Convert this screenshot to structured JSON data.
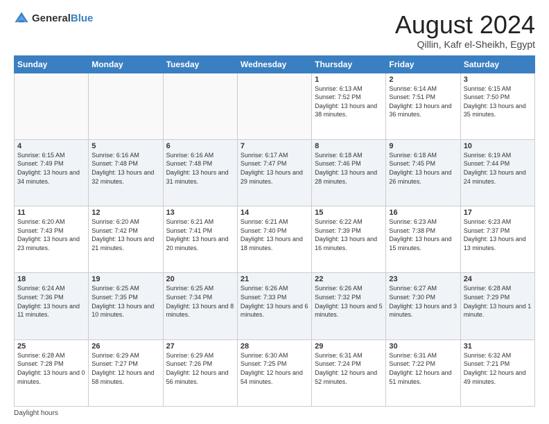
{
  "header": {
    "logo": {
      "general": "General",
      "blue": "Blue"
    },
    "title": "August 2024",
    "location": "Qillin, Kafr el-Sheikh, Egypt"
  },
  "days_of_week": [
    "Sunday",
    "Monday",
    "Tuesday",
    "Wednesday",
    "Thursday",
    "Friday",
    "Saturday"
  ],
  "weeks": [
    [
      {
        "day": "",
        "empty": true
      },
      {
        "day": "",
        "empty": true
      },
      {
        "day": "",
        "empty": true
      },
      {
        "day": "",
        "empty": true
      },
      {
        "day": "1",
        "sunrise": "6:13 AM",
        "sunset": "7:52 PM",
        "daylight": "13 hours and 38 minutes."
      },
      {
        "day": "2",
        "sunrise": "6:14 AM",
        "sunset": "7:51 PM",
        "daylight": "13 hours and 36 minutes."
      },
      {
        "day": "3",
        "sunrise": "6:15 AM",
        "sunset": "7:50 PM",
        "daylight": "13 hours and 35 minutes."
      }
    ],
    [
      {
        "day": "4",
        "sunrise": "6:15 AM",
        "sunset": "7:49 PM",
        "daylight": "13 hours and 34 minutes."
      },
      {
        "day": "5",
        "sunrise": "6:16 AM",
        "sunset": "7:48 PM",
        "daylight": "13 hours and 32 minutes."
      },
      {
        "day": "6",
        "sunrise": "6:16 AM",
        "sunset": "7:48 PM",
        "daylight": "13 hours and 31 minutes."
      },
      {
        "day": "7",
        "sunrise": "6:17 AM",
        "sunset": "7:47 PM",
        "daylight": "13 hours and 29 minutes."
      },
      {
        "day": "8",
        "sunrise": "6:18 AM",
        "sunset": "7:46 PM",
        "daylight": "13 hours and 28 minutes."
      },
      {
        "day": "9",
        "sunrise": "6:18 AM",
        "sunset": "7:45 PM",
        "daylight": "13 hours and 26 minutes."
      },
      {
        "day": "10",
        "sunrise": "6:19 AM",
        "sunset": "7:44 PM",
        "daylight": "13 hours and 24 minutes."
      }
    ],
    [
      {
        "day": "11",
        "sunrise": "6:20 AM",
        "sunset": "7:43 PM",
        "daylight": "13 hours and 23 minutes."
      },
      {
        "day": "12",
        "sunrise": "6:20 AM",
        "sunset": "7:42 PM",
        "daylight": "13 hours and 21 minutes."
      },
      {
        "day": "13",
        "sunrise": "6:21 AM",
        "sunset": "7:41 PM",
        "daylight": "13 hours and 20 minutes."
      },
      {
        "day": "14",
        "sunrise": "6:21 AM",
        "sunset": "7:40 PM",
        "daylight": "13 hours and 18 minutes."
      },
      {
        "day": "15",
        "sunrise": "6:22 AM",
        "sunset": "7:39 PM",
        "daylight": "13 hours and 16 minutes."
      },
      {
        "day": "16",
        "sunrise": "6:23 AM",
        "sunset": "7:38 PM",
        "daylight": "13 hours and 15 minutes."
      },
      {
        "day": "17",
        "sunrise": "6:23 AM",
        "sunset": "7:37 PM",
        "daylight": "13 hours and 13 minutes."
      }
    ],
    [
      {
        "day": "18",
        "sunrise": "6:24 AM",
        "sunset": "7:36 PM",
        "daylight": "13 hours and 11 minutes."
      },
      {
        "day": "19",
        "sunrise": "6:25 AM",
        "sunset": "7:35 PM",
        "daylight": "13 hours and 10 minutes."
      },
      {
        "day": "20",
        "sunrise": "6:25 AM",
        "sunset": "7:34 PM",
        "daylight": "13 hours and 8 minutes."
      },
      {
        "day": "21",
        "sunrise": "6:26 AM",
        "sunset": "7:33 PM",
        "daylight": "13 hours and 6 minutes."
      },
      {
        "day": "22",
        "sunrise": "6:26 AM",
        "sunset": "7:32 PM",
        "daylight": "13 hours and 5 minutes."
      },
      {
        "day": "23",
        "sunrise": "6:27 AM",
        "sunset": "7:30 PM",
        "daylight": "13 hours and 3 minutes."
      },
      {
        "day": "24",
        "sunrise": "6:28 AM",
        "sunset": "7:29 PM",
        "daylight": "13 hours and 1 minute."
      }
    ],
    [
      {
        "day": "25",
        "sunrise": "6:28 AM",
        "sunset": "7:28 PM",
        "daylight": "13 hours and 0 minutes."
      },
      {
        "day": "26",
        "sunrise": "6:29 AM",
        "sunset": "7:27 PM",
        "daylight": "12 hours and 58 minutes."
      },
      {
        "day": "27",
        "sunrise": "6:29 AM",
        "sunset": "7:26 PM",
        "daylight": "12 hours and 56 minutes."
      },
      {
        "day": "28",
        "sunrise": "6:30 AM",
        "sunset": "7:25 PM",
        "daylight": "12 hours and 54 minutes."
      },
      {
        "day": "29",
        "sunrise": "6:31 AM",
        "sunset": "7:24 PM",
        "daylight": "12 hours and 52 minutes."
      },
      {
        "day": "30",
        "sunrise": "6:31 AM",
        "sunset": "7:22 PM",
        "daylight": "12 hours and 51 minutes."
      },
      {
        "day": "31",
        "sunrise": "6:32 AM",
        "sunset": "7:21 PM",
        "daylight": "12 hours and 49 minutes."
      }
    ]
  ],
  "footer": {
    "daylight_label": "Daylight hours"
  }
}
